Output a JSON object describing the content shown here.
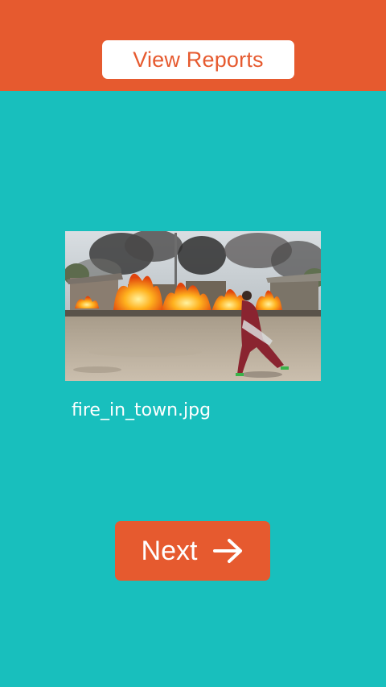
{
  "header": {
    "background_color": "#e65a2f",
    "view_reports_label": "View Reports"
  },
  "main": {
    "background_color": "#18bfbd",
    "image": {
      "description_icon": "photo-thumbnail",
      "file_name": "fire_in_town.jpg"
    },
    "next_button": {
      "label": "Next",
      "icon": "arrow-right-icon"
    }
  }
}
